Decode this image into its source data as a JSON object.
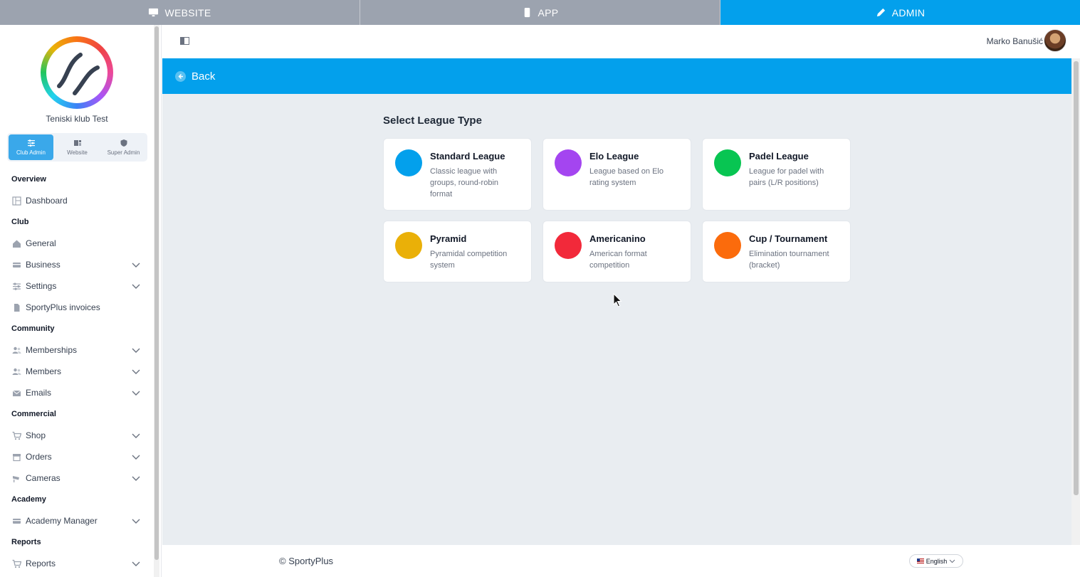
{
  "topbar": {
    "tabs": [
      {
        "label": "WEBSITE",
        "icon": "monitor-icon",
        "active": false
      },
      {
        "label": "APP",
        "icon": "phone-icon",
        "active": false
      },
      {
        "label": "ADMIN",
        "icon": "pencil-icon",
        "active": true
      }
    ]
  },
  "sidebar": {
    "club_name": "Teniski klub Test",
    "roles": [
      {
        "label": "Club Admin",
        "icon": "sliders-icon",
        "active": true
      },
      {
        "label": "Website",
        "icon": "layout-icon",
        "active": false
      },
      {
        "label": "Super Admin",
        "icon": "shield-icon",
        "active": false
      }
    ],
    "sections": [
      {
        "title": "Overview",
        "items": [
          {
            "label": "Dashboard",
            "icon": "dashboard-icon",
            "expandable": false
          }
        ]
      },
      {
        "title": "Club",
        "items": [
          {
            "label": "General",
            "icon": "home-icon",
            "expandable": false
          },
          {
            "label": "Business",
            "icon": "card-icon",
            "expandable": true
          },
          {
            "label": "Settings",
            "icon": "sliders-icon",
            "expandable": true
          },
          {
            "label": "SportyPlus invoices",
            "icon": "document-icon",
            "expandable": false
          }
        ]
      },
      {
        "title": "Community",
        "items": [
          {
            "label": "Memberships",
            "icon": "users-icon",
            "expandable": true
          },
          {
            "label": "Members",
            "icon": "users-icon",
            "expandable": true
          },
          {
            "label": "Emails",
            "icon": "mail-icon",
            "expandable": true
          }
        ]
      },
      {
        "title": "Commercial",
        "items": [
          {
            "label": "Shop",
            "icon": "cart-icon",
            "expandable": true
          },
          {
            "label": "Orders",
            "icon": "box-icon",
            "expandable": true
          },
          {
            "label": "Cameras",
            "icon": "camera-icon",
            "expandable": true
          }
        ]
      },
      {
        "title": "Academy",
        "items": [
          {
            "label": "Academy Manager",
            "icon": "card-icon",
            "expandable": true
          }
        ]
      },
      {
        "title": "Reports",
        "items": [
          {
            "label": "Reports",
            "icon": "cart-icon",
            "expandable": true
          }
        ]
      }
    ]
  },
  "header": {
    "user_name": "Marko Banušić"
  },
  "backbar": {
    "label": "Back"
  },
  "main": {
    "title": "Select League Type",
    "cards": [
      {
        "title": "Standard League",
        "desc": "Classic league with groups, round-robin format",
        "color": "#03a0ec"
      },
      {
        "title": "Elo League",
        "desc": "League based on Elo rating system",
        "color": "#a445f0"
      },
      {
        "title": "Padel League",
        "desc": "League for padel with pairs (L/R positions)",
        "color": "#08c552"
      },
      {
        "title": "Pyramid",
        "desc": "Pyramidal competition system",
        "color": "#eab008"
      },
      {
        "title": "Americanino",
        "desc": "American format competition",
        "color": "#f2293a"
      },
      {
        "title": "Cup / Tournament",
        "desc": "Elimination tournament (bracket)",
        "color": "#fb6b0c"
      }
    ]
  },
  "footer": {
    "copyright": "© SportyPlus",
    "language": "English"
  }
}
